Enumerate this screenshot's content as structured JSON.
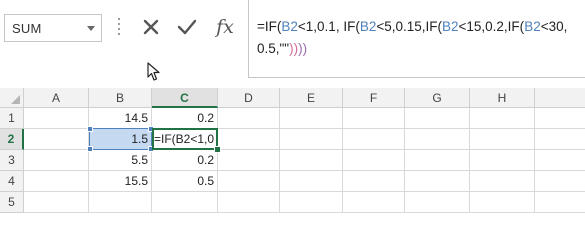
{
  "name_box": {
    "value": "SUM"
  },
  "formula_bar": {
    "cancel_icon": "close-icon",
    "enter_icon": "check-icon",
    "function_label": "fx",
    "formula_line1": [
      {
        "t": "=IF(",
        "c": "n"
      },
      {
        "t": "B2",
        "c": "r"
      },
      {
        "t": "<1,0.1, IF(",
        "c": "n"
      },
      {
        "t": "B2",
        "c": "r"
      },
      {
        "t": "<5,0.15,IF(",
        "c": "n"
      },
      {
        "t": "B2",
        "c": "r"
      },
      {
        "t": "<15,0.2,IF(",
        "c": "n"
      },
      {
        "t": "B2",
        "c": "r"
      },
      {
        "t": "<30,",
        "c": "n"
      }
    ],
    "formula_line2": [
      {
        "t": "0.5,\"\"",
        "c": "n"
      },
      {
        "t": "))",
        "c": "p"
      },
      {
        "t": "))",
        "c": "d"
      }
    ]
  },
  "grid": {
    "columns": [
      "A",
      "B",
      "C",
      "D",
      "E",
      "F",
      "G",
      "H"
    ],
    "active_column": "C",
    "rows": [
      {
        "num": "1",
        "cells": {
          "B": "14.5",
          "C": "0.2"
        }
      },
      {
        "num": "2",
        "cells": {
          "B": "1.5",
          "C": "=IF(B2<1,0"
        }
      },
      {
        "num": "3",
        "cells": {
          "B": "5.5",
          "C": "0.2"
        }
      },
      {
        "num": "4",
        "cells": {
          "B": "15.5",
          "C": "0.5"
        }
      },
      {
        "num": "5",
        "cells": {}
      }
    ],
    "active_row": "2",
    "editing_cell": "C2",
    "referenced_cell": "B2"
  }
}
